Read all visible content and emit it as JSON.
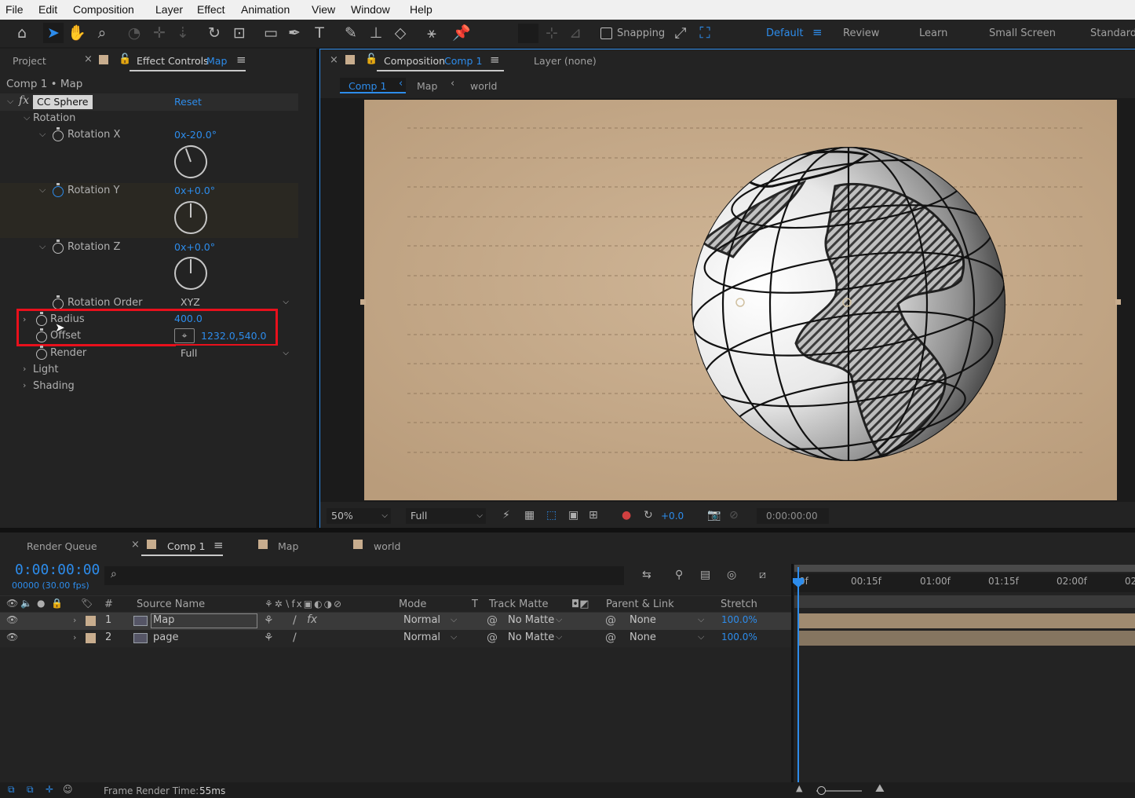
{
  "menu": [
    "File",
    "Edit",
    "Composition",
    "Layer",
    "Effect",
    "Animation",
    "View",
    "Window",
    "Help"
  ],
  "toolbar": {
    "snapping_label": "Snapping",
    "workspaces": [
      "Default",
      "Review",
      "Learn",
      "Small Screen",
      "Standard"
    ]
  },
  "left_panel": {
    "tab_project": "Project",
    "tab_effect_controls": "Effect Controls",
    "tab_effect_controls_layer": "Map",
    "breadcrumb": "Comp 1 • Map",
    "effect_name": "CC Sphere",
    "reset_label": "Reset",
    "rotation_group": "Rotation",
    "rotation_x_label": "Rotation X",
    "rotation_x_value": "0x-20.0°",
    "rotation_y_label": "Rotation Y",
    "rotation_y_value": "0x+0.0°",
    "rotation_z_label": "Rotation Z",
    "rotation_z_value": "0x+0.0°",
    "rotation_order_label": "Rotation Order",
    "rotation_order_value": "XYZ",
    "radius_label": "Radius",
    "radius_value": "400.0",
    "offset_label": "Offset",
    "offset_value": "1232.0,540.0",
    "render_label": "Render",
    "render_value": "Full",
    "light_label": "Light",
    "shading_label": "Shading"
  },
  "viewer": {
    "tab_label": "Composition",
    "tab_comp": "Comp 1",
    "layer_tab": "Layer (none)",
    "crumbs": [
      "Comp 1",
      "Map",
      "world"
    ],
    "zoom": "50%",
    "resolution": "Full",
    "exposure": "+0.0",
    "timecode": "0:00:00:00"
  },
  "timeline": {
    "tabs": [
      "Render Queue",
      "Comp 1",
      "Map",
      "world"
    ],
    "current_time": "0:00:00:00",
    "frame_info": "00000 (30.00 fps)",
    "search_placeholder": "",
    "columns": {
      "num": "#",
      "source": "Source Name",
      "mode": "Mode",
      "t": "T",
      "track_matte": "Track Matte",
      "parent": "Parent & Link",
      "stretch": "Stretch"
    },
    "layers": [
      {
        "num": "1",
        "name": "Map",
        "mode": "Normal",
        "matte": "No Matte",
        "parent": "None",
        "stretch": "100.0%"
      },
      {
        "num": "2",
        "name": "page",
        "mode": "Normal",
        "matte": "No Matte",
        "parent": "None",
        "stretch": "100.0%"
      }
    ],
    "ruler": [
      "0f",
      "00:15f",
      "01:00f",
      "01:15f",
      "02:00f",
      "02"
    ]
  },
  "status": {
    "frame_render_label": "Frame Render Time:",
    "frame_render_value": "55ms"
  },
  "colors": {
    "accent": "#2d8ceb",
    "highlight_box": "#e8101c",
    "paper": "#c8ad8e"
  }
}
